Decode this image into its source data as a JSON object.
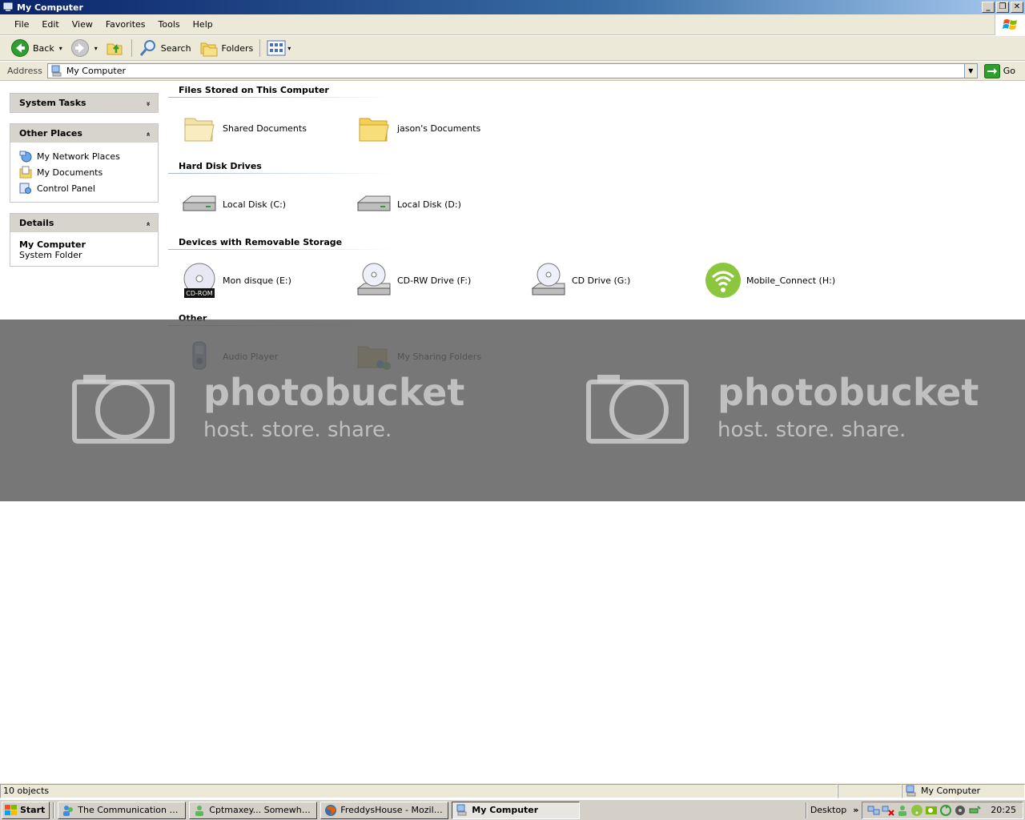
{
  "window": {
    "title": "My Computer",
    "minimize_glyph": "_",
    "maximize_glyph": "❐",
    "close_glyph": "✕"
  },
  "menu": {
    "items": [
      "File",
      "Edit",
      "View",
      "Favorites",
      "Tools",
      "Help"
    ]
  },
  "toolbar": {
    "back_label": "Back",
    "search_label": "Search",
    "folders_label": "Folders",
    "dropdown_glyph": "▾"
  },
  "address": {
    "label": "Address",
    "value": "My Computer",
    "go_label": "Go"
  },
  "sidebar": {
    "system_tasks": {
      "title": "System Tasks",
      "chevron": "»"
    },
    "other_places": {
      "title": "Other Places",
      "chevron": "«",
      "items": [
        "My Network Places",
        "My Documents",
        "Control Panel"
      ]
    },
    "details": {
      "title": "Details",
      "chevron": "«",
      "name": "My Computer",
      "type": "System Folder"
    }
  },
  "groups": [
    {
      "title": "Files Stored on This Computer",
      "items": [
        "Shared Documents",
        "jason's Documents"
      ]
    },
    {
      "title": "Hard Disk Drives",
      "items": [
        "Local Disk (C:)",
        "Local Disk (D:)"
      ]
    },
    {
      "title": "Devices with Removable Storage",
      "items": [
        "Mon disque (E:)",
        "CD-RW Drive (F:)",
        "CD Drive (G:)",
        "Mobile_Connect (H:)"
      ]
    },
    {
      "title": "Other",
      "items": [
        "Audio Player",
        "My Sharing Folders"
      ]
    }
  ],
  "cdrom_badge": "CD-ROM",
  "watermark": {
    "line1": "photobucket",
    "line2": "host. store. share."
  },
  "status": {
    "objects": "10 objects",
    "zone": "My Computer"
  },
  "taskbar": {
    "start_label": "Start",
    "buttons": [
      "The Communication Cons...",
      "Cptmaxey... Somewhere...",
      "FreddysHouse - Mozilla F...",
      "My Computer"
    ],
    "desktop_label": "Desktop",
    "more_glyph": "»",
    "clock": "20:25"
  },
  "colors": {
    "titlebar": "#0a246a",
    "chrome": "#ece9d8",
    "watermark_band": "#5f5f5f",
    "go_green": "#2f9e2f",
    "back_green": "#2f9e2f"
  }
}
